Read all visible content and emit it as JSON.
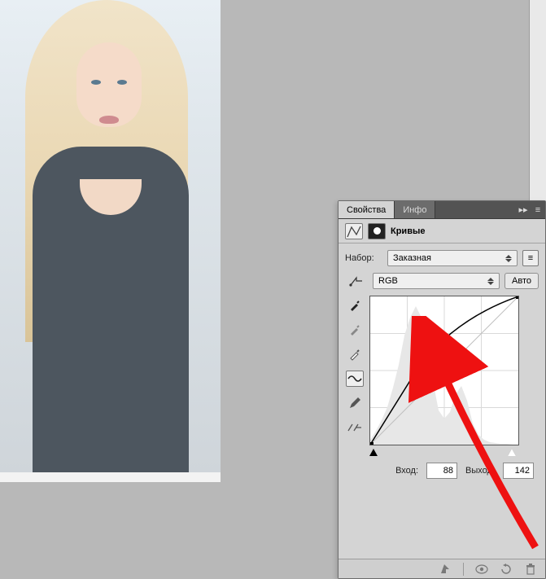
{
  "panel": {
    "tabs": [
      {
        "label": "Свойства",
        "active": true
      },
      {
        "label": "Инфо",
        "active": false
      }
    ],
    "title": "Кривые",
    "presetLabel": "Набор:",
    "presetValue": "Заказная",
    "channelValue": "RGB",
    "autoLabel": "Авто",
    "inputLabel": "Вход:",
    "inputValue": "88",
    "outputLabel": "Выход:",
    "outputValue": "142"
  },
  "icons": {
    "collapse": "▸▸",
    "menu": "≡"
  },
  "chart_data": {
    "type": "line",
    "title": "Кривые",
    "xlabel": "Вход",
    "ylabel": "Выход",
    "xlim": [
      0,
      255
    ],
    "ylim": [
      0,
      255
    ],
    "series": [
      {
        "name": "RGB",
        "points": [
          {
            "x": 0,
            "y": 0
          },
          {
            "x": 88,
            "y": 142
          },
          {
            "x": 255,
            "y": 255
          }
        ]
      }
    ],
    "histogram": [
      5,
      18,
      28,
      40,
      60,
      85,
      120,
      160,
      180,
      160,
      120,
      80,
      40,
      28,
      32,
      48,
      66,
      55,
      30,
      15,
      8,
      4,
      2,
      1,
      1,
      0
    ]
  }
}
